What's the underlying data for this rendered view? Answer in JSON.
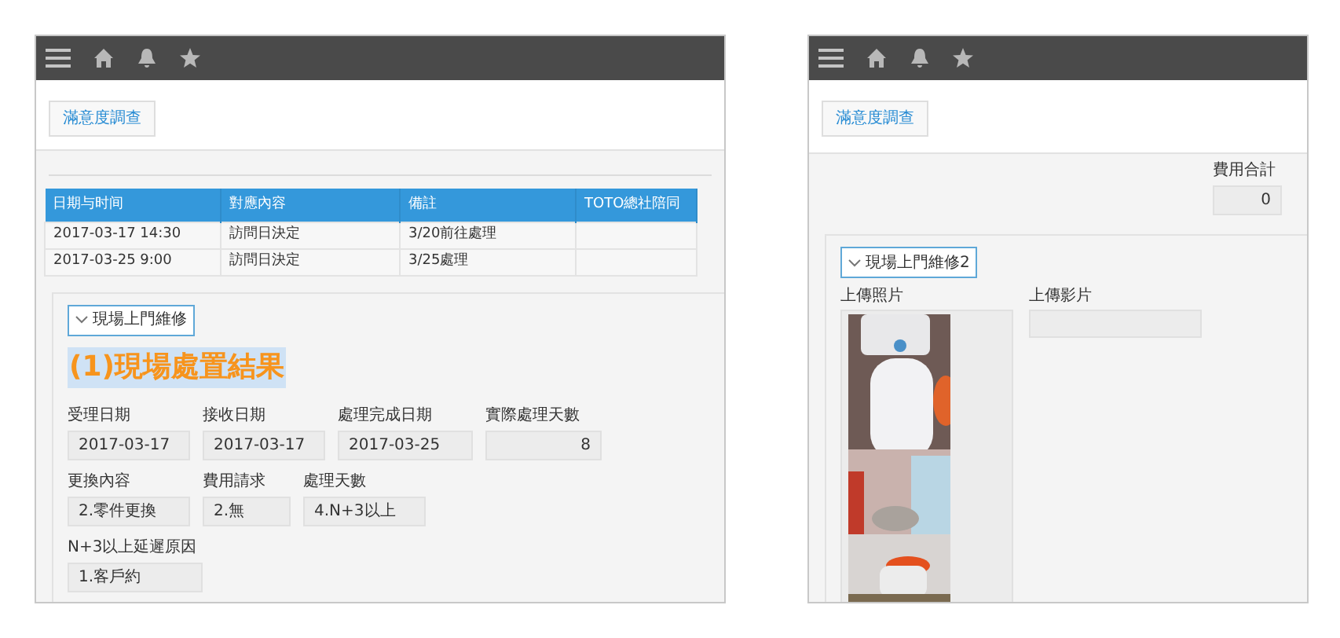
{
  "left_screen": {
    "survey_button": "滿意度調查",
    "table": {
      "columns": [
        "日期与时间",
        "對應內容",
        "備註",
        "TOTO總社陪同"
      ],
      "rows": [
        [
          "2017-03-17 14:30",
          "訪問日決定",
          "3/20前往處理",
          ""
        ],
        [
          "2017-03-25 9:00",
          "訪問日決定",
          "3/25處理",
          ""
        ]
      ]
    },
    "section": {
      "toggle": "現場上門維修",
      "expanded": true,
      "heading": "(1)現場處置結果",
      "heading_highlighted": true,
      "field_rows": [
        [
          {
            "label": "受理日期",
            "value": "2017-03-17",
            "kind": "text"
          },
          {
            "label": "接收日期",
            "value": "2017-03-17",
            "kind": "text"
          },
          {
            "label": "處理完成日期",
            "value": "2017-03-25",
            "kind": "text"
          },
          {
            "label": "實際處理天數",
            "value": "8",
            "kind": "number"
          }
        ],
        [
          {
            "label": "更換內容",
            "value": "2.零件更換",
            "kind": "text"
          },
          {
            "label": "費用請求",
            "value": "2.無",
            "kind": "text"
          },
          {
            "label": "處理天數",
            "value": "4.N+3以上",
            "kind": "text"
          }
        ],
        [
          {
            "label": "N+3以上延遲原因",
            "value": "1.客戶約",
            "kind": "text"
          }
        ]
      ]
    }
  },
  "right_screen": {
    "survey_button": "滿意度調查",
    "total": {
      "label": "費用合計",
      "value": "0",
      "kind": "number"
    },
    "section": {
      "toggle": "現場上門維修2",
      "expanded": true,
      "photo_label": "上傳照片",
      "video_label": "上傳影片"
    }
  }
}
